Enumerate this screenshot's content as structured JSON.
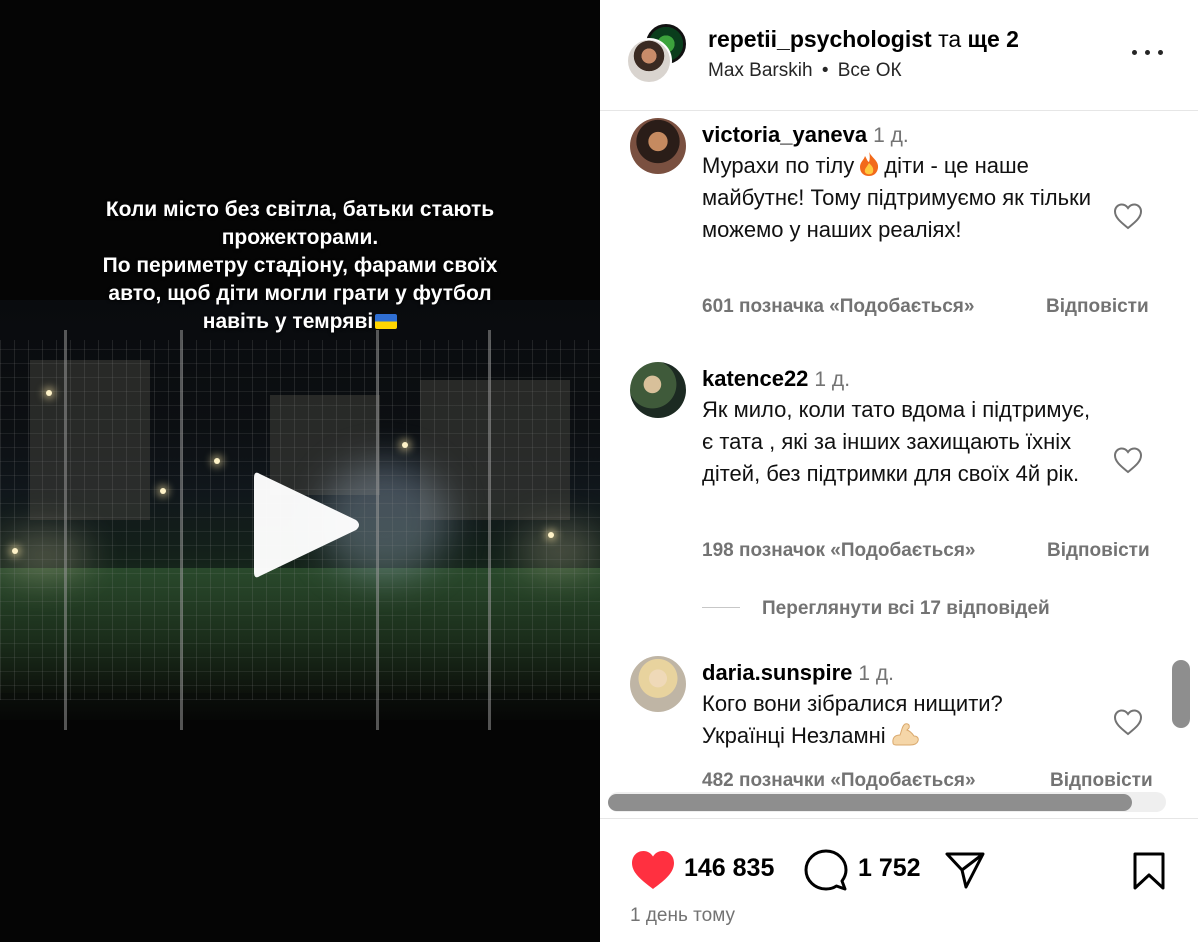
{
  "post": {
    "caption_lines": [
      "Коли місто без світла, батьки стають",
      "прожекторами.",
      "По периметру стадіону, фарами своїх",
      "авто, щоб діти могли грати у футбол",
      "навіть у темряві"
    ],
    "flag_icon": "ukraine-flag-icon",
    "play_icon": "play-icon"
  },
  "header": {
    "username": "repetii_psychologist",
    "connector": "та",
    "others": "ще 2",
    "audio": "Max Barskih",
    "separator": "•",
    "song": "Все ОК",
    "more_icon": "more-options-icon"
  },
  "comments": [
    {
      "user": "victoria_yaneva",
      "time": "1 д.",
      "text_before_emoji": "Мурахи по тілу",
      "emoji": "fire-emoji-icon",
      "text_after_emoji": "діти - це наше майбутнє! Тому підтримуємо як тільки можемо у наших реаліях!",
      "likes": "601 позначка «Подобається»",
      "reply": "Відповісти"
    },
    {
      "user": "katence22",
      "time": "1 д.",
      "text": "Як мило, коли тато вдома і підтримує, є тата , які за інших захищають їхніх дітей, без підтримки для своїх 4й рік.",
      "likes": "198 позначок «Подобається»",
      "reply": "Відповісти"
    },
    {
      "user": "daria.sunspire",
      "time": "1 д.",
      "text_line1": "Кого вони зібралися нищити?",
      "text_line2": "Українці Незламні",
      "emoji": "flexed-biceps-emoji-icon",
      "likes": "482 позначки «Подобається»",
      "reply": "Відповісти"
    }
  ],
  "view_replies": "Переглянути всі 17 відповідей",
  "footer": {
    "likes_count": "146 835",
    "comments_count": "1 752",
    "time_ago": "1 день тому",
    "like_color": "#ff3040"
  }
}
